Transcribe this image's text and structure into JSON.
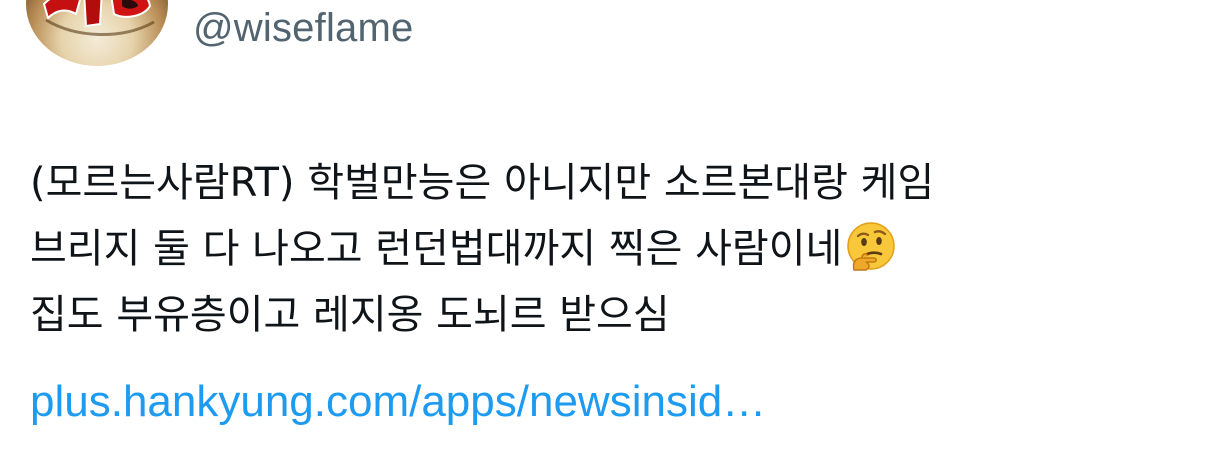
{
  "author": {
    "handle": "@wiseflame"
  },
  "tweet": {
    "lines": [
      "(모르는사람RT) 학벌만능은 아니지만 소르본대랑 케임",
      "브리지 둘 다 나오고 런던법대까지 찍은 사람이네",
      "집도 부유층이고 레지옹 도뇌르 받으심"
    ],
    "emoji": "thinking-face",
    "link_text": "plus.hankyung.com/apps/newsinsid…"
  },
  "colors": {
    "text": "#0f1419",
    "secondary": "#536471",
    "link": "#1d9bf0"
  }
}
